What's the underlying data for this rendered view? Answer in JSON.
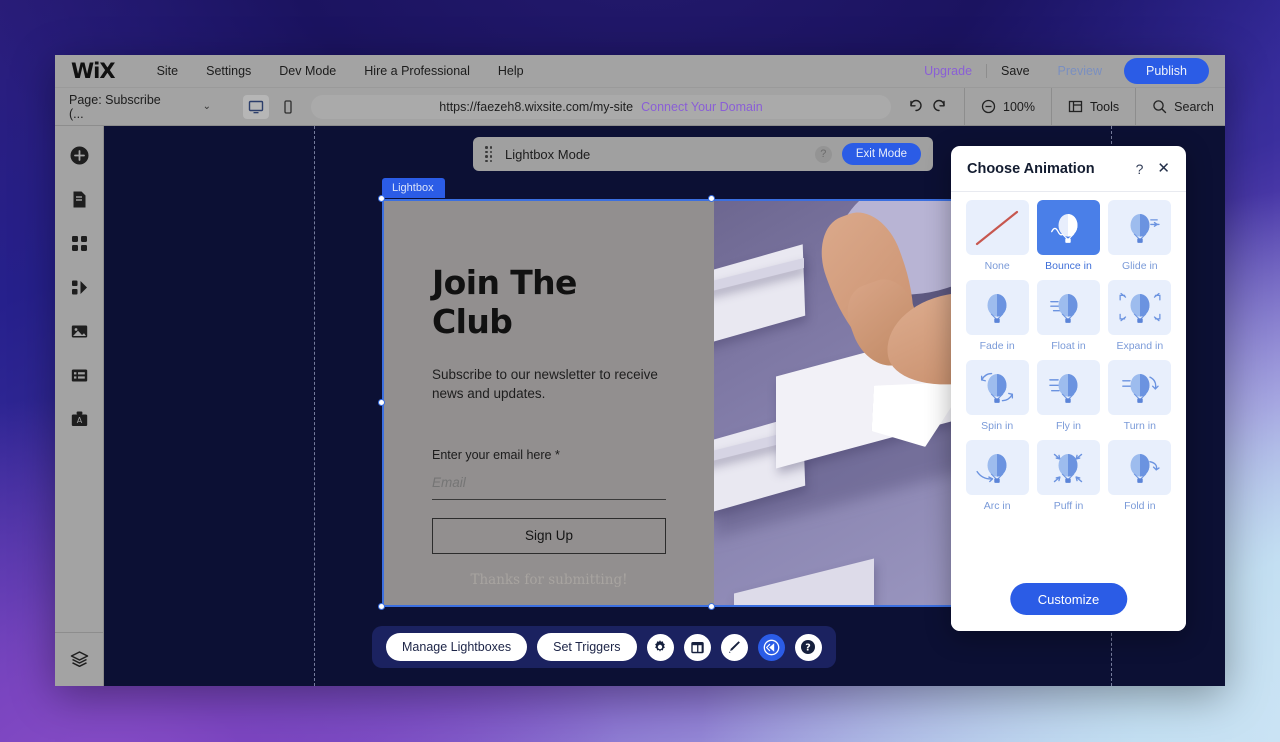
{
  "window": {
    "top_tab_icon": "chevron-up-icon"
  },
  "topbar": {
    "logo": "WiX",
    "menu": [
      {
        "label": "Site"
      },
      {
        "label": "Settings"
      },
      {
        "label": "Dev Mode"
      },
      {
        "label": "Hire a Professional"
      },
      {
        "label": "Help"
      }
    ],
    "upgrade": "Upgrade",
    "save": "Save",
    "preview": "Preview",
    "publish": "Publish"
  },
  "subbar": {
    "page_label": "Page: Subscribe (...",
    "desktop_icon": "desktop-icon",
    "mobile_icon": "mobile-icon",
    "url": "https://faezeh8.wixsite.com/my-site",
    "connect_domain": "Connect Your Domain",
    "undo_icon": "undo-icon",
    "redo_icon": "redo-icon",
    "zoom_icon": "zoom-out-icon",
    "zoom_level": "100%",
    "tools_icon": "tools-panel-icon",
    "tools_label": "Tools",
    "search_icon": "search-icon",
    "search_label": "Search"
  },
  "left_rail": {
    "items": [
      {
        "icon": "add-plus-icon",
        "name": "add-elements"
      },
      {
        "icon": "pages-document-icon",
        "name": "site-pages"
      },
      {
        "icon": "apps-grid-icon",
        "name": "app-market"
      },
      {
        "icon": "add-section-icon",
        "name": "add-section"
      },
      {
        "icon": "image-media-icon",
        "name": "my-media"
      },
      {
        "icon": "database-table-icon",
        "name": "content-manager"
      },
      {
        "icon": "blog-briefcase-icon",
        "name": "business-tools"
      }
    ],
    "bottom": {
      "icon": "layers-icon",
      "name": "layers"
    }
  },
  "lightbox_mode_bar": {
    "drag_handle_icon": "drag-dots-icon",
    "title": "Lightbox Mode",
    "help_icon": "question-mark-icon",
    "exit_label": "Exit Mode"
  },
  "lightbox": {
    "tag": "Lightbox",
    "title": "Join The Club",
    "subtitle": "Subscribe to our newsletter to receive news and updates.",
    "field_label": "Enter your email here *",
    "field_placeholder": "Email",
    "field_value": "",
    "submit_label": "Sign Up",
    "thanks": "Thanks for submitting!"
  },
  "bottom_toolbar": {
    "manage": "Manage Lightboxes",
    "triggers": "Set Triggers",
    "icons": [
      {
        "icon": "gear-settings-icon",
        "name": "settings-button",
        "active": false
      },
      {
        "icon": "layout-icon",
        "name": "layout-button",
        "active": false
      },
      {
        "icon": "brush-design-icon",
        "name": "design-button",
        "active": false
      },
      {
        "icon": "animation-icon",
        "name": "animation-button",
        "active": true
      },
      {
        "icon": "help-question-icon",
        "name": "help-button",
        "active": false
      }
    ]
  },
  "animation_panel": {
    "title": "Choose Animation",
    "help_icon": "question-mark-icon",
    "close_icon": "close-x-icon",
    "customize_label": "Customize",
    "selected": "Bounce in",
    "options": [
      {
        "label": "None",
        "icon": "none-slash-icon"
      },
      {
        "label": "Bounce in",
        "icon": "balloon-bounce-icon"
      },
      {
        "label": "Glide in",
        "icon": "balloon-glide-icon"
      },
      {
        "label": "Fade in",
        "icon": "balloon-fade-icon"
      },
      {
        "label": "Float in",
        "icon": "balloon-float-icon"
      },
      {
        "label": "Expand in",
        "icon": "balloon-expand-icon"
      },
      {
        "label": "Spin in",
        "icon": "balloon-spin-icon"
      },
      {
        "label": "Fly in",
        "icon": "balloon-fly-icon"
      },
      {
        "label": "Turn in",
        "icon": "balloon-turn-icon"
      },
      {
        "label": "Arc in",
        "icon": "balloon-arc-icon"
      },
      {
        "label": "Puff in",
        "icon": "balloon-puff-icon"
      },
      {
        "label": "Fold in",
        "icon": "balloon-fold-icon"
      }
    ]
  },
  "colors": {
    "accent_blue": "#2b5ce6",
    "canvas_dark": "#0c1034",
    "chrome_gray": "#a3a3a3",
    "purple_link": "#8a5fd6"
  }
}
